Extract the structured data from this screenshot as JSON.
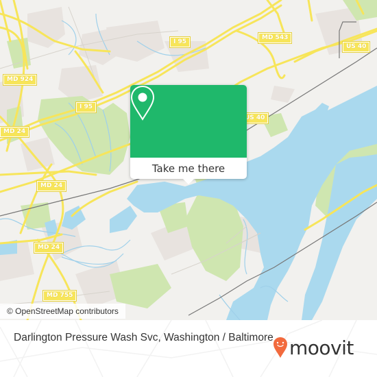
{
  "map": {
    "road_labels": [
      {
        "id": "i95-top",
        "text": "I 95"
      },
      {
        "id": "md543",
        "text": "MD 543"
      },
      {
        "id": "us40-top",
        "text": "US 40"
      },
      {
        "id": "md924",
        "text": "MD 924"
      },
      {
        "id": "i95-mid",
        "text": "I 95"
      },
      {
        "id": "us40-mid",
        "text": "US 40"
      },
      {
        "id": "md24-a",
        "text": "MD 24"
      },
      {
        "id": "md24-b",
        "text": "MD 24"
      },
      {
        "id": "md24-c",
        "text": "MD 24"
      },
      {
        "id": "md755",
        "text": "MD 755"
      }
    ],
    "colors": {
      "land": "#f2f1ee",
      "water": "#aad9ee",
      "park": "#cfe6b0",
      "urban": "#e8e3df",
      "road": "#f7e55a",
      "railway": "#777777"
    }
  },
  "popup": {
    "icon": "map-pin-icon",
    "button_label": "Take me there",
    "color": "#1fb86b"
  },
  "attribution": "© OpenStreetMap contributors",
  "footer": {
    "place_name": "Darlington Pressure Wash Svc, Washington / Baltimore",
    "logo_text": "moovit",
    "logo_color": "#f26a3d"
  }
}
